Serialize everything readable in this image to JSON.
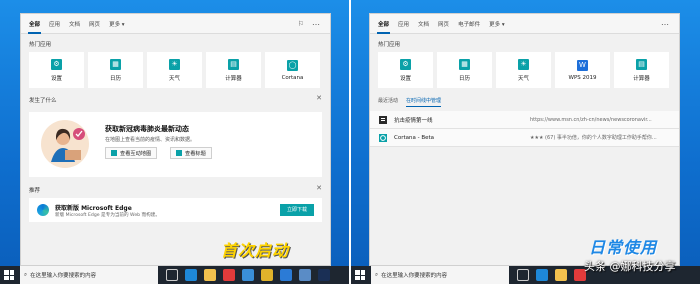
{
  "left": {
    "tabs": [
      "全部",
      "应用",
      "文档",
      "网页",
      "更多 ▾"
    ],
    "hot_apps_title": "热门应用",
    "apps": [
      {
        "label": "设置",
        "icon": "gear-icon",
        "glyph": "⚙"
      },
      {
        "label": "日历",
        "icon": "calendar-icon",
        "glyph": "▦"
      },
      {
        "label": "天气",
        "icon": "weather-icon",
        "glyph": "☀"
      },
      {
        "label": "计算器",
        "icon": "calculator-icon",
        "glyph": "▤"
      },
      {
        "label": "Cortana",
        "icon": "cortana-icon",
        "glyph": "◯"
      }
    ],
    "news_section_title": "发生了什么",
    "news": {
      "title": "获取新冠病毒肺炎最新动态",
      "desc": "在地图上查看当前的疫情、资讯和数据。",
      "btn_map": "查看互动地图",
      "btn_headlines": "查看标题"
    },
    "rec_section_title": "推荐",
    "rec": {
      "title": "获取新版 Microsoft Edge",
      "desc": "新版 Microsoft Edge 是专为当前的 Web 而构建。",
      "button": "立即下载"
    },
    "banner": "首次启动"
  },
  "right": {
    "tabs": [
      "全部",
      "应用",
      "文档",
      "网页",
      "电子邮件",
      "更多 ▾"
    ],
    "hot_apps_title": "热门应用",
    "apps": [
      {
        "label": "设置",
        "icon": "gear-icon",
        "glyph": "⚙"
      },
      {
        "label": "日历",
        "icon": "calendar-icon",
        "glyph": "▦"
      },
      {
        "label": "天气",
        "icon": "weather-icon",
        "glyph": "☀"
      },
      {
        "label": "WPS 2019",
        "icon": "wps-icon",
        "glyph": "W"
      },
      {
        "label": "计算器",
        "icon": "calculator-icon",
        "glyph": "▤"
      }
    ],
    "recent_title": "最近活动",
    "recent_tab": "在时间线中管理",
    "recent": [
      {
        "title": "抗击疫情第一线",
        "sub": "https://www.msn.cn/zh-cn/news/newscoronavir..."
      },
      {
        "title": "Cortana - Beta",
        "sub": "★★★ (67) 事半功倍，你的个人数字助理工作助手帮你..."
      }
    ],
    "banner": "日常使用"
  },
  "taskbar": {
    "search_placeholder": "在这里输入你要搜索的内容"
  },
  "watermark": "头条 @娜科技分享"
}
